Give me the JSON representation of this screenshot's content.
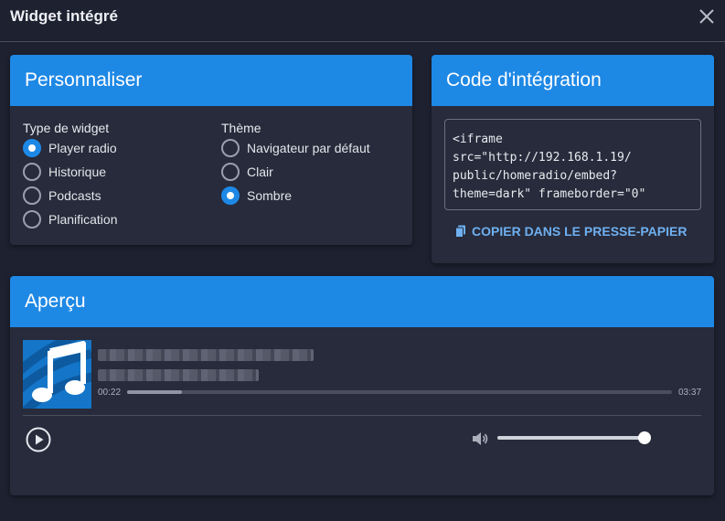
{
  "modal": {
    "title": "Widget intégré"
  },
  "customize": {
    "title": "Personnaliser",
    "widget_type": {
      "label": "Type de widget",
      "options": [
        "Player radio",
        "Historique",
        "Podcasts",
        "Planification"
      ],
      "selected": 0
    },
    "theme": {
      "label": "Thème",
      "options": [
        "Navigateur par défaut",
        "Clair",
        "Sombre"
      ],
      "selected": 2
    }
  },
  "embed": {
    "title": "Code d'intégration",
    "code": "<iframe\nsrc=\"http://192.168.1.19/\npublic/homeradio/embed?\ntheme=dark\" frameborder=\"0\"",
    "copy_label": "COPIER DANS LE PRESSE-PAPIER"
  },
  "preview": {
    "title": "Aperçu",
    "elapsed": "00:22",
    "duration": "03:37",
    "progress_fraction": 0.1,
    "volume_fraction": 1.0
  },
  "colors": {
    "accent": "#1e88e5",
    "background": "#1e2130",
    "card": "#272b3b"
  },
  "icons": [
    "close-icon",
    "copy-icon",
    "music-note-icon",
    "play-icon",
    "volume-icon"
  ]
}
